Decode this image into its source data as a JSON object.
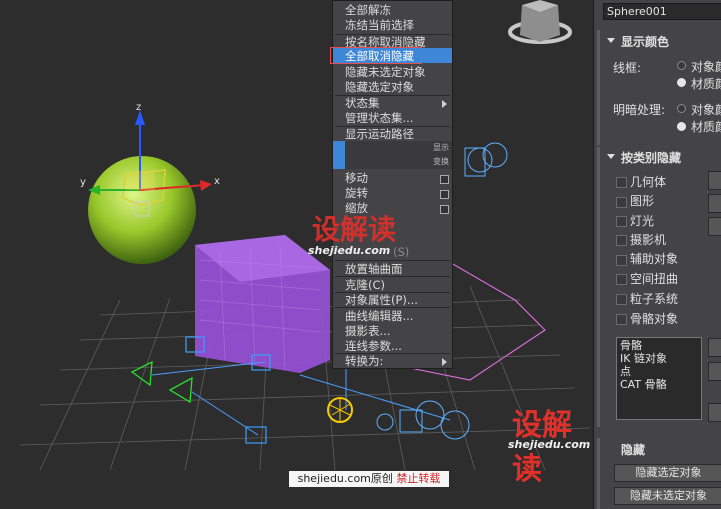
{
  "viewport": {
    "axis_labels": {
      "z": "z",
      "y": "y",
      "x": "x"
    }
  },
  "context_menu": {
    "items": [
      {
        "label": "全部解冻"
      },
      {
        "label": "冻结当前选择"
      },
      {
        "label": "按名称取消隐藏"
      },
      {
        "label": "全部取消隐藏",
        "highlighted": true
      },
      {
        "label": "隐藏未选定对象"
      },
      {
        "label": "隐藏选定对象"
      },
      {
        "label": "状态集",
        "has_submenu": true
      },
      {
        "label": "管理状态集..."
      },
      {
        "label": "显示运动路径"
      },
      {
        "label": "移动"
      },
      {
        "label": "旋转"
      },
      {
        "label": "缩放"
      },
      {
        "label": "放置轴曲面"
      },
      {
        "label": "克隆(C)"
      },
      {
        "label": "对象属性(P)..."
      },
      {
        "label": "曲线编辑器..."
      },
      {
        "label": "摄影表..."
      },
      {
        "label": "连线参数..."
      },
      {
        "label": "转换为:",
        "has_submenu": true
      }
    ],
    "quad_headers": {
      "display": "显示",
      "transform": "变换"
    },
    "dim_item": "(S)"
  },
  "panel": {
    "object_name": "Sphere001",
    "display_color": {
      "title": "显示颜色",
      "wireframe_label": "线框:",
      "shaded_label": "明暗处理:",
      "options": [
        "对象颜色",
        "材质颜色"
      ],
      "wireframe_selected": 1,
      "shaded_selected": 1
    },
    "hide_by_category": {
      "title": "按类别隐藏",
      "categories": [
        "几何体",
        "图形",
        "灯光",
        "摄影机",
        "辅助对象",
        "空间扭曲",
        "粒子系统",
        "骨骼对象"
      ],
      "list_items": [
        "骨骼",
        "IK 链对象",
        "点",
        "CAT 骨骼"
      ]
    },
    "hide": {
      "title": "隐藏",
      "buttons": [
        "隐藏选定对象",
        "隐藏未选定对象"
      ]
    }
  },
  "watermark": {
    "brand": "设解读",
    "domain": "shejiedu.com",
    "credit_prefix": "shejiedu.com原创",
    "credit_suffix": "禁止转载"
  },
  "colors": {
    "highlight": "#3d87d6",
    "sphere": "#9ccc2a",
    "box": "#9a55d6",
    "watermark_red": "#e0302a"
  }
}
